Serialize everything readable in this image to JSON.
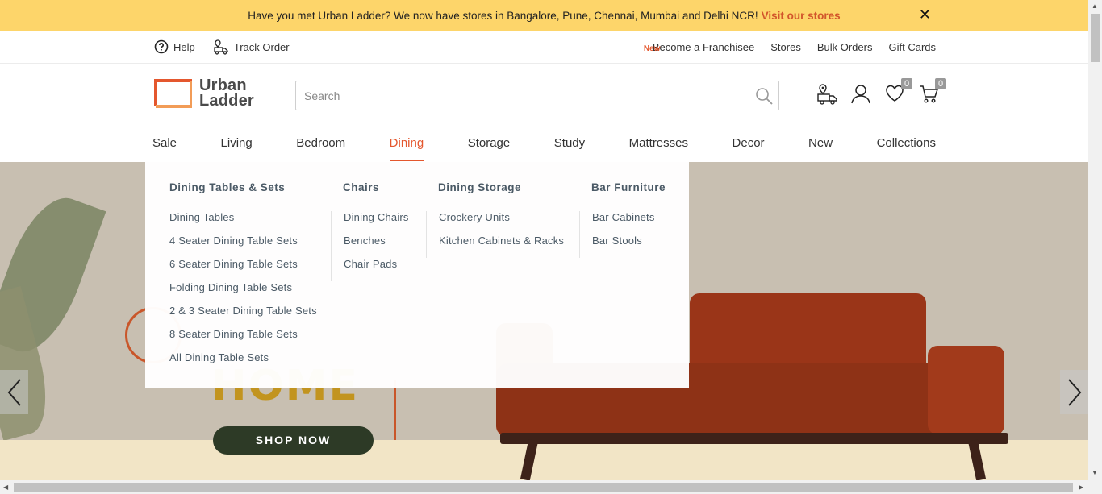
{
  "promo": {
    "message": "Have you met Urban Ladder? We now have stores in Bangalore, Pune, Chennai, Mumbai and Delhi NCR!",
    "link": "Visit our stores",
    "close": "✕"
  },
  "utility": {
    "help": "Help",
    "track_order": "Track Order",
    "new_tag": "New",
    "right_links": [
      "Become a Franchisee",
      "Stores",
      "Bulk Orders",
      "Gift Cards"
    ]
  },
  "logo": {
    "line1": "Urban",
    "line2": "Ladder"
  },
  "search": {
    "placeholder": "Search"
  },
  "counts": {
    "wishlist": "0",
    "cart": "0"
  },
  "nav": [
    "Sale",
    "Living",
    "Bedroom",
    "Dining",
    "Storage",
    "Study",
    "Mattresses",
    "Decor",
    "New",
    "Collections"
  ],
  "mega_menu": {
    "columns": [
      {
        "heading": "Dining Tables & Sets",
        "items": [
          "Dining Tables",
          "4 Seater Dining Table Sets",
          "6 Seater Dining Table Sets",
          "Folding Dining Table Sets",
          "2 & 3 Seater Dining Table Sets",
          "8 Seater Dining Table Sets",
          "All Dining Table Sets"
        ]
      },
      {
        "heading": "Chairs",
        "items": [
          "Dining Chairs",
          "Benches",
          "Chair Pads"
        ]
      },
      {
        "heading": "Dining Storage",
        "items": [
          "Crockery Units",
          "Kitchen Cabinets & Racks"
        ]
      },
      {
        "heading": "Bar Furniture",
        "items": [
          "Bar Cabinets",
          "Bar Stools"
        ]
      }
    ]
  },
  "hero": {
    "headline": "HOME",
    "cta": "SHOP NOW"
  },
  "colors": {
    "accent": "#e4572e",
    "promo_bg": "#fdd56a",
    "menu_text": "#4b5a66"
  }
}
